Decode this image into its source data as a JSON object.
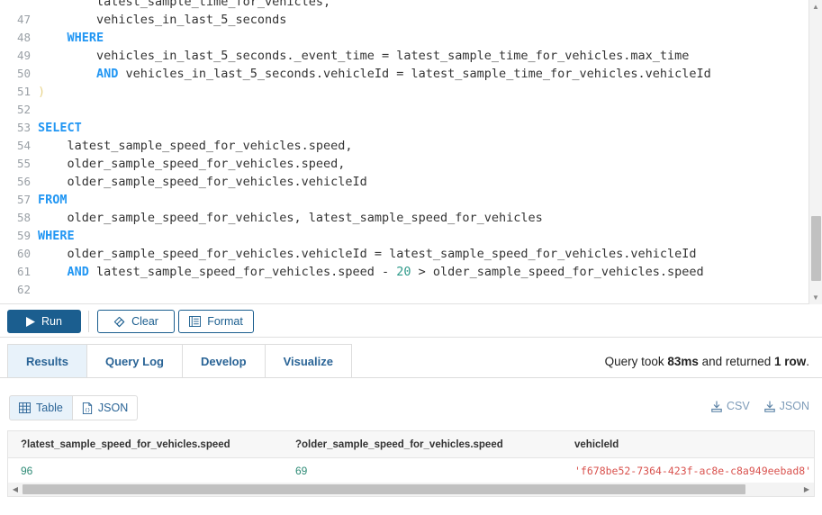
{
  "editor": {
    "first_visible_line": 47,
    "lines": [
      {
        "num": "",
        "tokens": [
          {
            "t": "clipped",
            "s": "        latest_sample_time_for_vehicles,"
          }
        ]
      },
      {
        "num": "47",
        "tokens": [
          {
            "t": "plain",
            "s": "        vehicles_in_last_5_seconds"
          }
        ]
      },
      {
        "num": "48",
        "tokens": [
          {
            "t": "plain",
            "s": "    "
          },
          {
            "t": "kw",
            "s": "WHERE"
          }
        ]
      },
      {
        "num": "49",
        "tokens": [
          {
            "t": "plain",
            "s": "        vehicles_in_last_5_seconds._event_time = latest_sample_time_for_vehicles.max_time"
          }
        ]
      },
      {
        "num": "50",
        "tokens": [
          {
            "t": "plain",
            "s": "        "
          },
          {
            "t": "kw",
            "s": "AND"
          },
          {
            "t": "plain",
            "s": " vehicles_in_last_5_seconds.vehicleId = latest_sample_time_for_vehicles.vehicleId"
          }
        ]
      },
      {
        "num": "51",
        "tokens": [
          {
            "t": "paren",
            "s": ")"
          }
        ]
      },
      {
        "num": "52",
        "tokens": [
          {
            "t": "plain",
            "s": ""
          }
        ]
      },
      {
        "num": "53",
        "tokens": [
          {
            "t": "kw",
            "s": "SELECT"
          }
        ]
      },
      {
        "num": "54",
        "tokens": [
          {
            "t": "plain",
            "s": "    latest_sample_speed_for_vehicles.speed,"
          }
        ]
      },
      {
        "num": "55",
        "tokens": [
          {
            "t": "plain",
            "s": "    older_sample_speed_for_vehicles.speed,"
          }
        ]
      },
      {
        "num": "56",
        "tokens": [
          {
            "t": "plain",
            "s": "    older_sample_speed_for_vehicles.vehicleId"
          }
        ]
      },
      {
        "num": "57",
        "tokens": [
          {
            "t": "kw",
            "s": "FROM"
          }
        ]
      },
      {
        "num": "58",
        "tokens": [
          {
            "t": "plain",
            "s": "    older_sample_speed_for_vehicles, latest_sample_speed_for_vehicles"
          }
        ]
      },
      {
        "num": "59",
        "tokens": [
          {
            "t": "kw",
            "s": "WHERE"
          }
        ]
      },
      {
        "num": "60",
        "tokens": [
          {
            "t": "plain",
            "s": "    older_sample_speed_for_vehicles.vehicleId = latest_sample_speed_for_vehicles.vehicleId"
          }
        ]
      },
      {
        "num": "61",
        "tokens": [
          {
            "t": "plain",
            "s": "    "
          },
          {
            "t": "kw",
            "s": "AND"
          },
          {
            "t": "plain",
            "s": " latest_sample_speed_for_vehicles.speed - "
          },
          {
            "t": "num",
            "s": "20"
          },
          {
            "t": "plain",
            "s": " > older_sample_speed_for_vehicles.speed"
          }
        ]
      },
      {
        "num": "62",
        "tokens": [
          {
            "t": "plain",
            "s": ""
          }
        ]
      }
    ]
  },
  "toolbar": {
    "run_label": "Run",
    "clear_label": "Clear",
    "format_label": "Format",
    "run_icon": "play-icon",
    "clear_icon": "eraser-icon",
    "format_icon": "indent-list-icon"
  },
  "tabs": [
    {
      "label": "Results",
      "active": true
    },
    {
      "label": "Query Log",
      "active": false
    },
    {
      "label": "Develop",
      "active": false
    },
    {
      "label": "Visualize",
      "active": false
    }
  ],
  "status": {
    "prefix": "Query took ",
    "duration": "83ms",
    "middle": " and returned ",
    "rows": "1 row",
    "suffix": "."
  },
  "view_switch": [
    {
      "label": "Table",
      "icon": "table-grid-icon",
      "active": true
    },
    {
      "label": "JSON",
      "icon": "json-file-icon",
      "active": false
    }
  ],
  "exports": [
    {
      "label": "CSV",
      "icon": "download-icon"
    },
    {
      "label": "JSON",
      "icon": "download-icon"
    }
  ],
  "results": {
    "columns": [
      "?latest_sample_speed_for_vehicles.speed",
      "?older_sample_speed_for_vehicles.speed",
      "vehicleId"
    ],
    "rows": [
      {
        "col1": "96",
        "col2": "69",
        "col3": "'f678be52-7364-423f-ac8e-c8a949eebad8'"
      }
    ]
  },
  "colors": {
    "accent": "#1b5e8f",
    "tab_text": "#2a6496",
    "tab_active_bg": "#e8f2fa",
    "keyword": "#2196f3",
    "number_literal": "#2e9a8a",
    "string_value": "#d9534f",
    "numeric_value": "#2e8b76"
  }
}
